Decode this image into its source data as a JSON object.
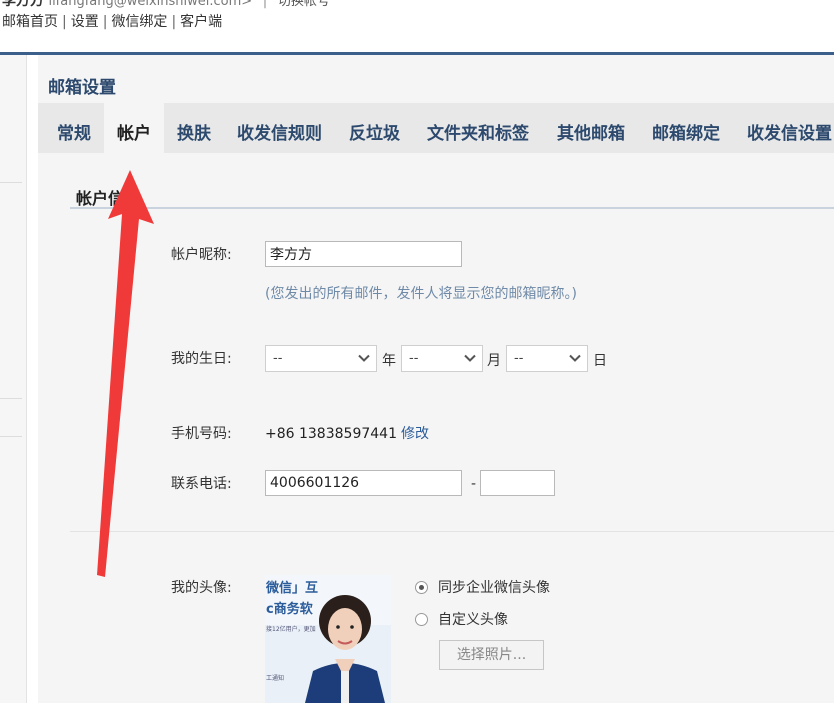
{
  "header": {
    "user_name": "李方方",
    "user_email": "lifangfang@weixinshiwei.com",
    "user_email_suffix": ">",
    "separator": "|",
    "switch_account": "切换帐号",
    "links": [
      "邮箱首页",
      "设置",
      "微信绑定",
      "客户端"
    ]
  },
  "panel": {
    "title": "邮箱设置",
    "tabs": [
      "常规",
      "帐户",
      "换肤",
      "收发信规则",
      "反垃圾",
      "文件夹和标签",
      "其他邮箱",
      "邮箱绑定",
      "收发信设置"
    ],
    "active_tab": "帐户"
  },
  "account": {
    "section_title": "帐户信息",
    "nickname_label": "帐户昵称:",
    "nickname_value": "李方方",
    "nickname_hint": "(您发出的所有邮件，发件人将显示您的邮箱昵称。)",
    "birthday_label": "我的生日:",
    "birthday_year": "--",
    "birthday_year_unit": "年",
    "birthday_month": "--",
    "birthday_month_unit": "月",
    "birthday_day": "--",
    "birthday_day_unit": "日",
    "phone_label": "手机号码:",
    "phone_value": "+86 13838597441",
    "phone_modify": "修改",
    "tel_label": "联系电话:",
    "tel_value": "4006601126",
    "tel_dash": "-",
    "tel_ext": "",
    "avatar_label": "我的头像:",
    "avatar_options": [
      "同步企业微信头像",
      "自定义头像"
    ],
    "avatar_selected": 0,
    "choose_photo": "选择照片...",
    "avatar_banner": {
      "line1": "微信」互",
      "line2": "c商务软",
      "line3": "接12亿用户，更加",
      "line4": "工通知"
    }
  },
  "colors": {
    "accent": "#2d4a6e",
    "header_rule": "#3a5f8a",
    "link": "#2b5c9b",
    "hint": "#6f8aa8",
    "annotation_arrow": "#f03a3a"
  },
  "icons": {
    "dropdown": "chevron-down-icon",
    "annotation": "red-arrow-icon"
  }
}
